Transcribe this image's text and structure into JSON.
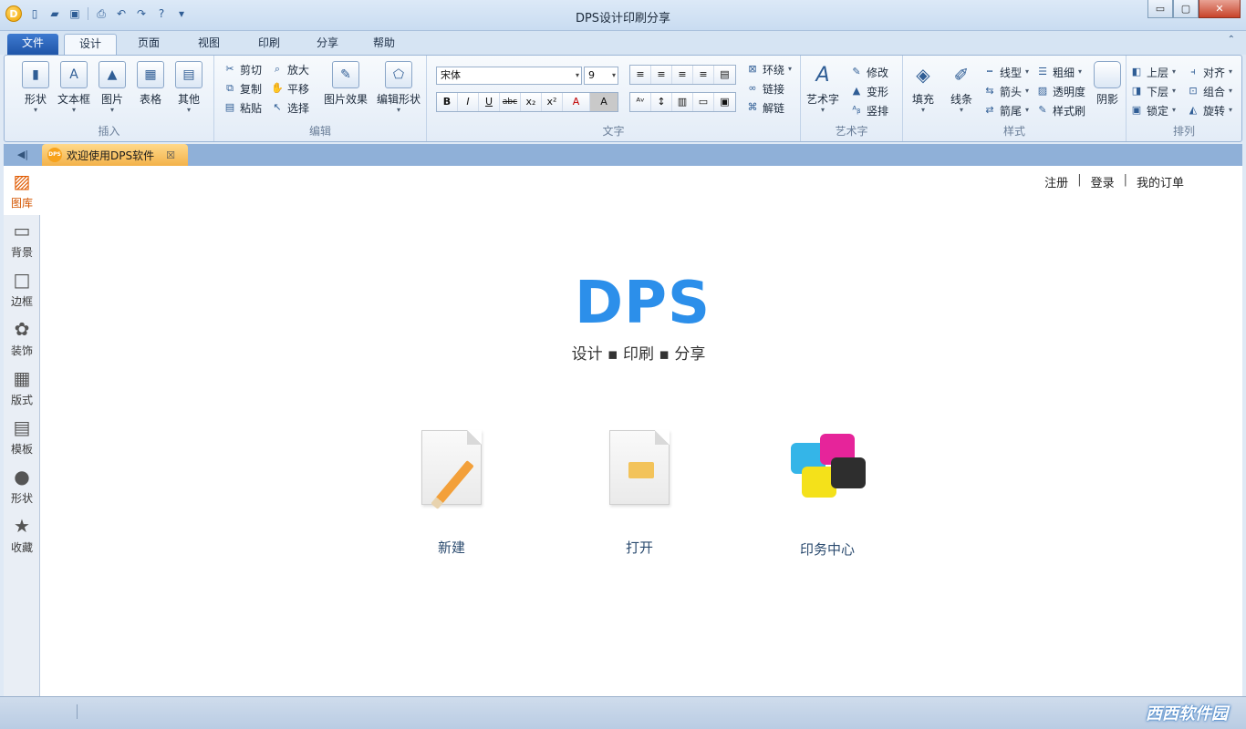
{
  "window": {
    "title": "DPS设计印刷分享",
    "logo_letter": "D",
    "controls": {
      "minimize": "▭",
      "maximize": "▢",
      "close": "✕"
    }
  },
  "ribbon_tabs": [
    "文件",
    "设计",
    "页面",
    "视图",
    "印刷",
    "分享",
    "帮助"
  ],
  "active_tab": "设计",
  "ribbon": {
    "insert": {
      "label": "插入",
      "buttons": [
        "形状",
        "文本框",
        "图片",
        "表格",
        "其他"
      ]
    },
    "edit": {
      "label": "编辑",
      "small": [
        "剪切",
        "复制",
        "粘贴",
        "放大",
        "平移",
        "选择"
      ],
      "big": [
        "图片效果",
        "编辑形状"
      ]
    },
    "text": {
      "label": "文字",
      "font_name": "宋体",
      "font_size": "9",
      "format_buttons": [
        "B",
        "I",
        "U",
        "abc",
        "x₂",
        "x²",
        "A",
        "A"
      ],
      "wrap": [
        "环绕",
        "链接",
        "解链"
      ]
    },
    "art": {
      "label": "艺术字",
      "big": "艺术字",
      "small": [
        "修改",
        "变形",
        "竖排"
      ]
    },
    "style": {
      "label": "样式",
      "big": [
        "填充",
        "线条"
      ],
      "small": [
        "线型",
        "箭头",
        "箭尾",
        "粗细",
        "透明度",
        "样式刷"
      ],
      "shadow": "阴影"
    },
    "arrange": {
      "label": "排列",
      "small": [
        "上层",
        "下层",
        "锁定",
        "对齐",
        "组合",
        "旋转"
      ]
    }
  },
  "document_tab": {
    "title": "欢迎使用DPS软件",
    "icon_text": "DPS"
  },
  "side_panel": [
    "图库",
    "背景",
    "边框",
    "装饰",
    "版式",
    "模板",
    "形状",
    "收藏"
  ],
  "top_links": [
    "注册",
    "登录",
    "我的订单"
  ],
  "welcome": {
    "logo": "DPS",
    "tagline": "设计 ▪ 印刷 ▪ 分享",
    "actions": [
      "新建",
      "打开",
      "印务中心"
    ]
  },
  "watermark": "西西软件园",
  "colors": {
    "brand_blue": "#2c8fea",
    "active_orange": "#e05a00"
  }
}
